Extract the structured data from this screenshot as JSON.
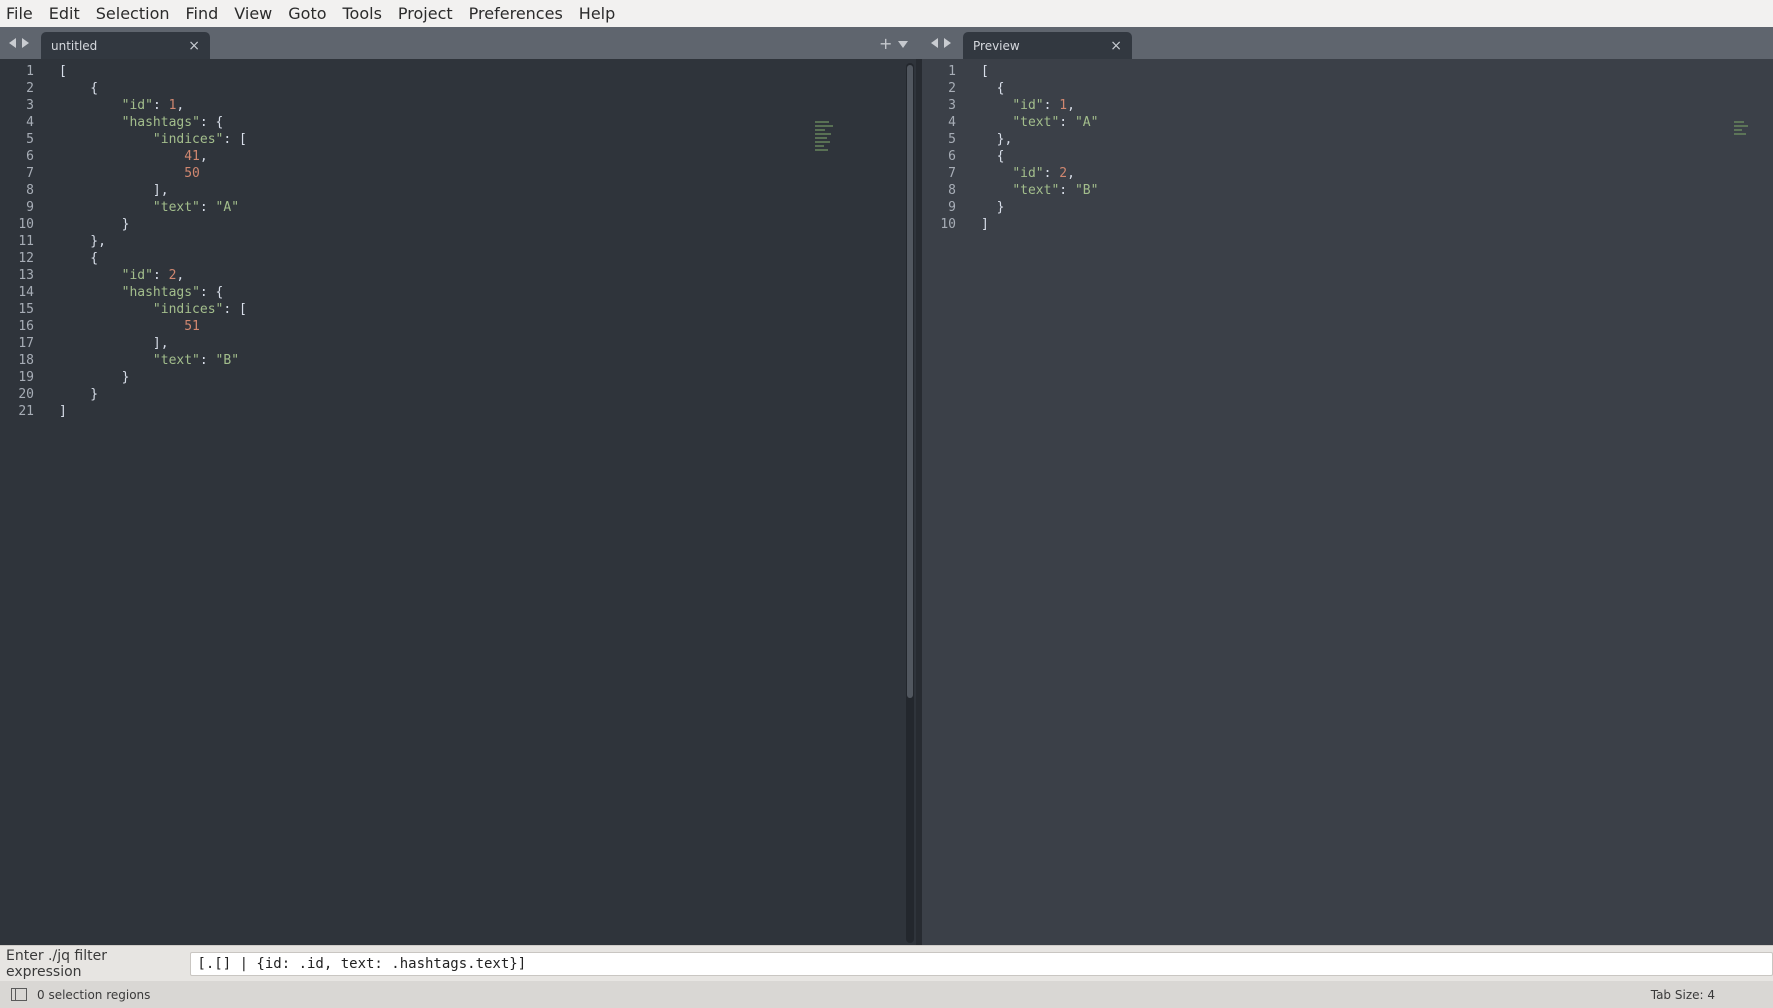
{
  "menu": [
    "File",
    "Edit",
    "Selection",
    "Find",
    "View",
    "Goto",
    "Tools",
    "Project",
    "Preferences",
    "Help"
  ],
  "left_tab": {
    "label": "untitled",
    "close": "×"
  },
  "right_tab": {
    "label": "Preview",
    "close": "×"
  },
  "left_editor": {
    "lines": [
      [
        [
          "punc",
          "["
        ]
      ],
      [
        [
          "punc",
          "    {"
        ]
      ],
      [
        [
          "punc",
          "        "
        ],
        [
          "key",
          "\"id\""
        ],
        [
          "punc",
          ": "
        ],
        [
          "num",
          "1"
        ],
        [
          "punc",
          ","
        ]
      ],
      [
        [
          "punc",
          "        "
        ],
        [
          "key",
          "\"hashtags\""
        ],
        [
          "punc",
          ": {"
        ]
      ],
      [
        [
          "punc",
          "            "
        ],
        [
          "key",
          "\"indices\""
        ],
        [
          "punc",
          ": ["
        ]
      ],
      [
        [
          "punc",
          "                "
        ],
        [
          "num",
          "41"
        ],
        [
          "punc",
          ","
        ]
      ],
      [
        [
          "punc",
          "                "
        ],
        [
          "num",
          "50"
        ]
      ],
      [
        [
          "punc",
          "            ],"
        ]
      ],
      [
        [
          "punc",
          "            "
        ],
        [
          "key",
          "\"text\""
        ],
        [
          "punc",
          ": "
        ],
        [
          "str",
          "\"A\""
        ]
      ],
      [
        [
          "punc",
          "        }"
        ]
      ],
      [
        [
          "punc",
          "    },"
        ]
      ],
      [
        [
          "punc",
          "    {"
        ]
      ],
      [
        [
          "punc",
          "        "
        ],
        [
          "key",
          "\"id\""
        ],
        [
          "punc",
          ": "
        ],
        [
          "num",
          "2"
        ],
        [
          "punc",
          ","
        ]
      ],
      [
        [
          "punc",
          "        "
        ],
        [
          "key",
          "\"hashtags\""
        ],
        [
          "punc",
          ": {"
        ]
      ],
      [
        [
          "punc",
          "            "
        ],
        [
          "key",
          "\"indices\""
        ],
        [
          "punc",
          ": ["
        ]
      ],
      [
        [
          "punc",
          "                "
        ],
        [
          "num",
          "51"
        ]
      ],
      [
        [
          "punc",
          "            ],"
        ]
      ],
      [
        [
          "punc",
          "            "
        ],
        [
          "key",
          "\"text\""
        ],
        [
          "punc",
          ": "
        ],
        [
          "str",
          "\"B\""
        ]
      ],
      [
        [
          "punc",
          "        }"
        ]
      ],
      [
        [
          "punc",
          "    }"
        ]
      ],
      [
        [
          "punc",
          "]"
        ]
      ]
    ]
  },
  "right_editor": {
    "lines": [
      [
        [
          "punc",
          "["
        ]
      ],
      [
        [
          "punc",
          "  {"
        ]
      ],
      [
        [
          "punc",
          "    "
        ],
        [
          "key",
          "\"id\""
        ],
        [
          "punc",
          ": "
        ],
        [
          "num",
          "1"
        ],
        [
          "punc",
          ","
        ]
      ],
      [
        [
          "punc",
          "    "
        ],
        [
          "key",
          "\"text\""
        ],
        [
          "punc",
          ": "
        ],
        [
          "str",
          "\"A\""
        ]
      ],
      [
        [
          "punc",
          "  },"
        ]
      ],
      [
        [
          "punc",
          "  {"
        ]
      ],
      [
        [
          "punc",
          "    "
        ],
        [
          "key",
          "\"id\""
        ],
        [
          "punc",
          ": "
        ],
        [
          "num",
          "2"
        ],
        [
          "punc",
          ","
        ]
      ],
      [
        [
          "punc",
          "    "
        ],
        [
          "key",
          "\"text\""
        ],
        [
          "punc",
          ": "
        ],
        [
          "str",
          "\"B\""
        ]
      ],
      [
        [
          "punc",
          "  }"
        ]
      ],
      [
        [
          "punc",
          "]"
        ]
      ]
    ]
  },
  "input_panel": {
    "label": "Enter ./jq filter expression",
    "value": "[.[] | {id: .id, text: .hashtags.text}]"
  },
  "status": {
    "selection": "0 selection regions",
    "tab_size": "Tab Size: 4"
  }
}
